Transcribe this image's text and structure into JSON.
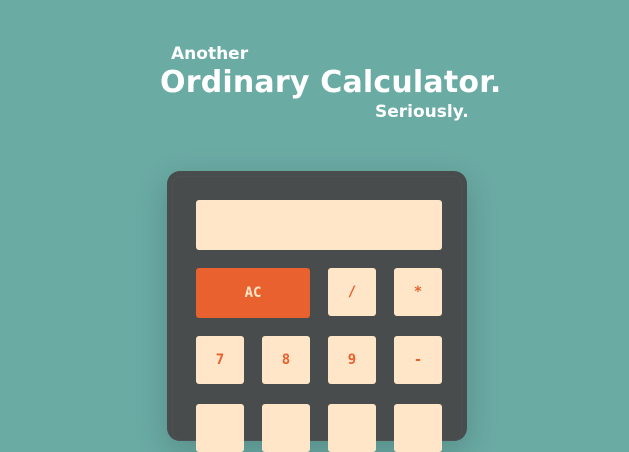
{
  "header": {
    "line1": "Another",
    "title": "Ordinary Calculator.",
    "line3": "Seriously."
  },
  "display": {
    "value": ""
  },
  "keys": {
    "ac": "AC",
    "divide": "/",
    "multiply": "*",
    "seven": "7",
    "eight": "8",
    "nine": "9",
    "minus": "-"
  },
  "colors": {
    "background": "#6aaba4",
    "body": "#494c4d",
    "key": "#ffe6c8",
    "accent": "#e8612f"
  }
}
